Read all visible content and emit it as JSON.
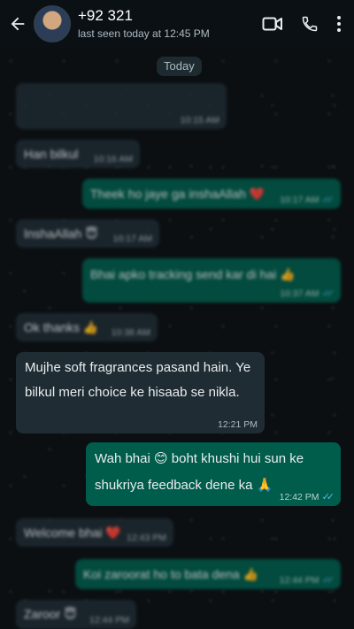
{
  "header": {
    "contact_name": "+92 321 ",
    "last_seen": "last seen today at 12:45 PM"
  },
  "date_chip": "Today",
  "messages": [
    {
      "text": "",
      "time": "10:15 AM"
    },
    {
      "text": "Han bilkul",
      "time": "10:16 AM"
    },
    {
      "text": "Theek ho jaye ga inshaAllah ❤️",
      "time": "10:17 AM"
    },
    {
      "text": "InshaAllah 😇",
      "time": "10:17 AM"
    },
    {
      "text": "Bhai apko tracking send kar di hai 👍",
      "time": "10:37 AM"
    },
    {
      "text": "Ok thanks 👍",
      "time": "10:38 AM"
    },
    {
      "text": "Mujhe soft fragrances pasand hain. Ye bilkul meri choice ke hisaab se nikla.",
      "time": "12:21 PM"
    },
    {
      "text": "Wah bhai 😊 boht khushi hui sun ke shukriya feedback dene ka 🙏",
      "time": "12:42 PM"
    },
    {
      "text": "Welcome bhai ❤️",
      "time": "12:43 PM"
    },
    {
      "text": "Koi zaroorat ho to bata dena 👍",
      "time": "12:44 PM"
    },
    {
      "text": "Zaroor 😇",
      "time": "12:44 PM"
    }
  ],
  "icons": [
    "back-arrow-icon",
    "video-call-icon",
    "phone-icon",
    "more-vert-icon"
  ],
  "colors": {
    "incoming": "#1f2c33",
    "outgoing": "#005c4b",
    "background": "#0b0f12",
    "read_ticks": "#53bdeb"
  }
}
